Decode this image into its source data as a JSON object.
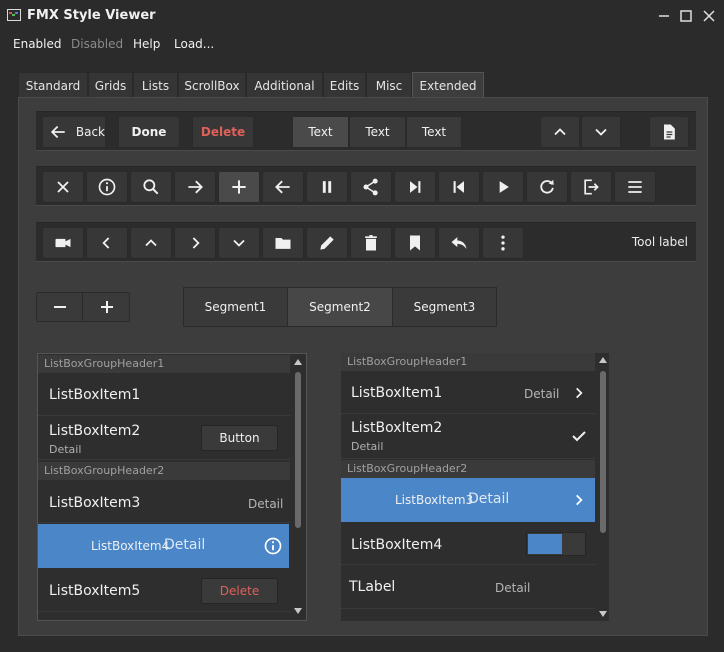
{
  "window": {
    "title": "FMX Style Viewer"
  },
  "menu": [
    "Enabled",
    "Disabled",
    "Help",
    "Load..."
  ],
  "tabs": [
    "Standard",
    "Grids",
    "Lists",
    "ScrollBox",
    "Additional",
    "Edits",
    "Misc",
    "Extended"
  ],
  "active_tab": "Extended",
  "toolbar1": {
    "back": "Back",
    "done": "Done",
    "delete": "Delete",
    "text_segments": [
      "Text",
      "Text",
      "Text"
    ],
    "icons": [
      "back-arrow-icon",
      "chevron-up-icon",
      "chevron-down-icon",
      "document-icon"
    ]
  },
  "toolbar2": {
    "icons": [
      "close-icon",
      "info-icon",
      "search-icon",
      "forward-arrow-icon",
      "add-icon",
      "back-arrow-icon",
      "pause-icon",
      "share-icon",
      "skip-forward-icon",
      "skip-back-icon",
      "play-icon",
      "refresh-icon",
      "logout-icon",
      "menu-icon"
    ]
  },
  "toolbar3": {
    "icons": [
      "camera-icon",
      "chevron-left-icon",
      "chevron-up-icon",
      "chevron-right-icon",
      "chevron-down-icon",
      "folder-icon",
      "pencil-icon",
      "trash-icon",
      "bookmark-icon",
      "reply-icon",
      "more-vertical-icon"
    ],
    "tool_label": "Tool label"
  },
  "segments": [
    "Segment1",
    "Segment2",
    "Segment3"
  ],
  "selected_segment": "Segment2",
  "left_list": {
    "group1": "ListBoxGroupHeader1",
    "item1": "ListBoxItem1",
    "item2": "ListBoxItem2",
    "item2_sub": "Detail",
    "item2_button": "Button",
    "group2": "ListBoxGroupHeader2",
    "item3": "ListBoxItem3",
    "item3_detail": "Detail",
    "item4": "ListBoxItem4",
    "item4_detail": "Detail",
    "item5": "ListBoxItem5",
    "item5_button": "Delete"
  },
  "right_list": {
    "group1": "ListBoxGroupHeader1",
    "item1": "ListBoxItem1",
    "item1_detail": "Detail",
    "item2": "ListBoxItem2",
    "item2_sub": "Detail",
    "group2": "ListBoxGroupHeader2",
    "item3": "ListBoxItem3",
    "item3_detail": "Detail",
    "item4": "ListBoxItem4",
    "label": "TLabel",
    "label_detail": "Detail"
  },
  "colors": {
    "accent": "#4a86c8",
    "delete": "#e0605a",
    "background": "#2b2b2b",
    "panel": "#3d3d3d"
  }
}
